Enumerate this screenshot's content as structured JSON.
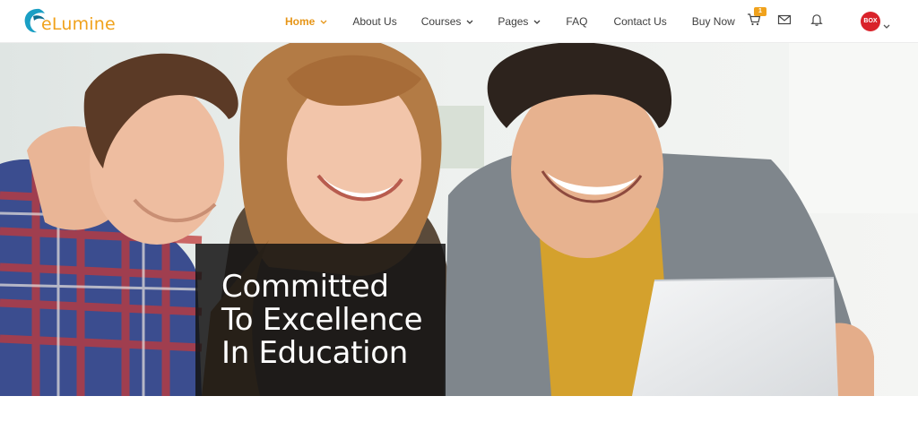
{
  "brand": {
    "name": "eLumine"
  },
  "nav": {
    "items": [
      {
        "label": "Home",
        "has_dropdown": true,
        "active": true
      },
      {
        "label": "About Us",
        "has_dropdown": false
      },
      {
        "label": "Courses",
        "has_dropdown": true
      },
      {
        "label": "Pages",
        "has_dropdown": true
      },
      {
        "label": "FAQ",
        "has_dropdown": false
      },
      {
        "label": "Contact Us",
        "has_dropdown": false
      },
      {
        "label": "Buy Now",
        "has_dropdown": false
      }
    ]
  },
  "header_icons": {
    "cart_icon": "cart-icon",
    "cart_count": "1",
    "mail_icon": "mail-icon",
    "notification_icon": "bell-icon",
    "avatar_text": "BOX"
  },
  "hero": {
    "headline_lines": [
      "Committed",
      "To Excellence",
      "In Education"
    ]
  },
  "colors": {
    "accent": "#f0a21c",
    "brand_blue": "#1a9fc4",
    "overlay": "#141414"
  }
}
